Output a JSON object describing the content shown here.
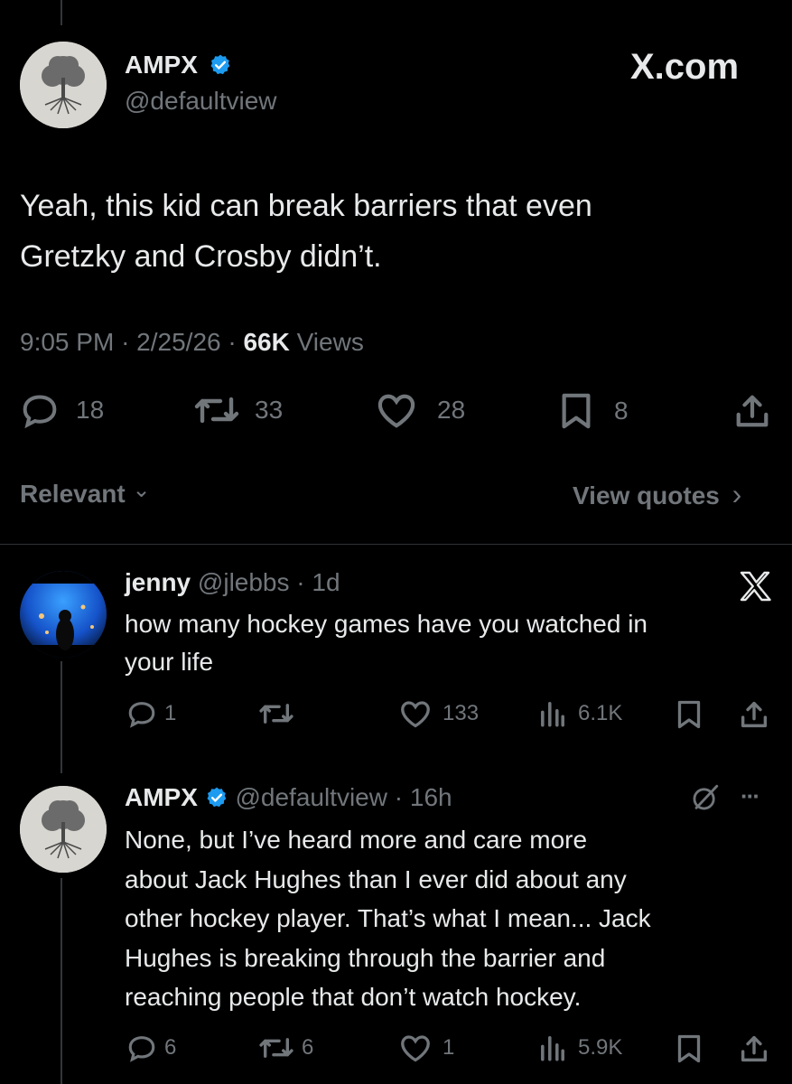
{
  "main_post": {
    "author_name": "AMPX",
    "handle": "@defaultview",
    "watermark": "X.com",
    "text_line1": "Yeah, this kid can break barriers that even",
    "text_line2": "Gretzky and Crosby didn’t.",
    "time": "9:05 PM",
    "date": "2/25/26",
    "dot": "·",
    "views_count": "66K",
    "views_label": "Views",
    "stats": {
      "replies": "18",
      "reposts": "33",
      "likes": "28",
      "bookmarks": "8"
    }
  },
  "filter_bar": {
    "sort_label": "Relevant",
    "sort_chevron": "⌄",
    "quotes_label": "View quotes",
    "quotes_chevron": "›"
  },
  "reply1": {
    "author_name": "jenny",
    "handle": "@jlebbs",
    "age": "1d",
    "text_line1": "how many hockey games have you watched in",
    "text_line2": "your life",
    "stats": {
      "replies": "1",
      "reposts": "",
      "likes": "133",
      "views": "6.1K"
    }
  },
  "reply2": {
    "author_name": "AMPX",
    "handle": "@defaultview",
    "age": "16h",
    "more": "···",
    "lines": [
      "None, but I’ve heard more and care more",
      "about Jack Hughes than I ever did about any",
      "other hockey player. That’s what I mean... Jack",
      "Hughes is breaking through the barrier and",
      "reaching people that don’t watch hockey."
    ],
    "stats": {
      "replies": "6",
      "reposts": "6",
      "likes": "1",
      "views": "5.9K"
    }
  },
  "colors": {
    "background": "#000000",
    "text": "#e7e9ea",
    "muted": "#71767b",
    "verified": "#1d9bf0"
  }
}
